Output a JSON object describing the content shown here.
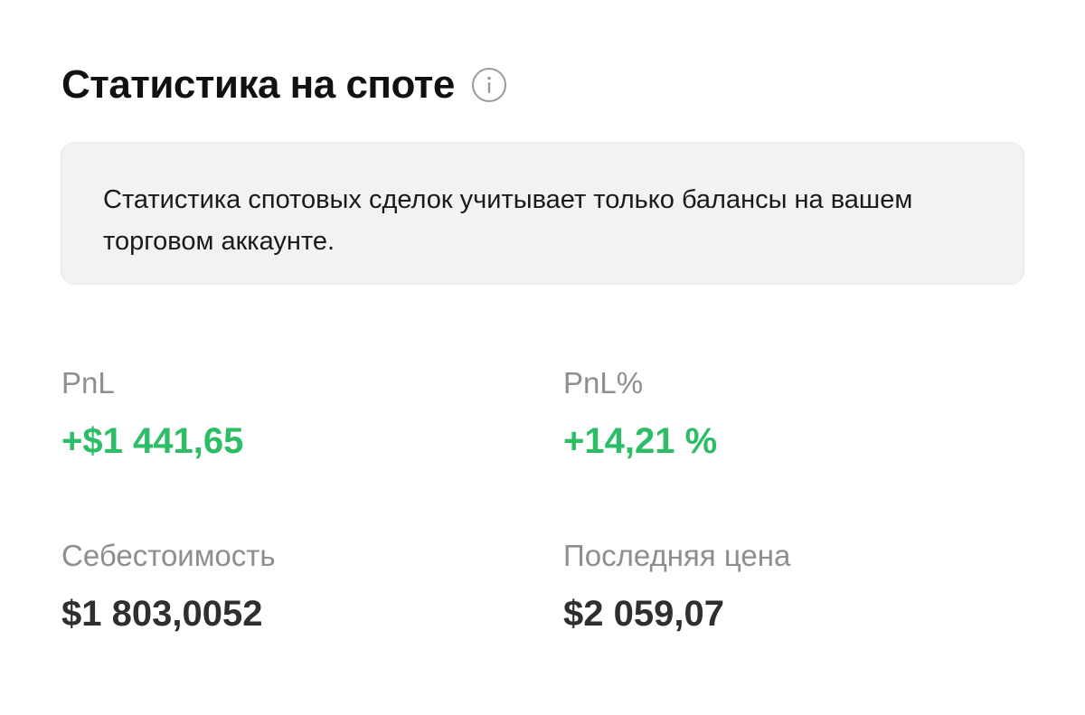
{
  "header": {
    "title": "Статистика на споте"
  },
  "notice": {
    "text": "Статистика спотовых сделок учитывает только балансы на вашем торговом аккаунте."
  },
  "stats": {
    "pnl": {
      "label": "PnL",
      "value": "+$1 441,65"
    },
    "pnl_percent": {
      "label": "PnL%",
      "value": "+14,21 %"
    },
    "cost_basis": {
      "label": "Себестоимость",
      "value": "$1 803,0052"
    },
    "last_price": {
      "label": "Последняя цена",
      "value": "$2 059,07"
    }
  },
  "colors": {
    "positive": "#2dbd66",
    "muted": "#8e8e8e",
    "notice_bg": "#f2f2f2"
  }
}
